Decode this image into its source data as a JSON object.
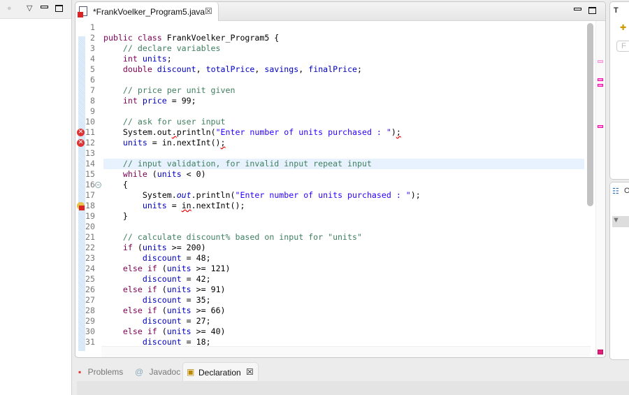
{
  "editor": {
    "tab_title": "*FrankVoelker_Program5.java",
    "close_glyph": "☒"
  },
  "code_lines": [
    [],
    [
      [
        "kw",
        "public class "
      ],
      [
        "",
        "FrankVoelker_Program5 {"
      ]
    ],
    [
      [
        "",
        "    "
      ],
      [
        "cm",
        "// declare variables"
      ]
    ],
    [
      [
        "",
        "    "
      ],
      [
        "kw",
        "int "
      ],
      [
        "fd",
        "units"
      ],
      [
        "",
        ";"
      ]
    ],
    [
      [
        "",
        "    "
      ],
      [
        "kw",
        "double "
      ],
      [
        "fd",
        "discount"
      ],
      [
        "",
        ", "
      ],
      [
        "fd",
        "totalPrice"
      ],
      [
        "",
        ", "
      ],
      [
        "fd",
        "savings"
      ],
      [
        "",
        ", "
      ],
      [
        "fd",
        "finalPrice"
      ],
      [
        "",
        ";"
      ]
    ],
    [],
    [
      [
        "",
        "    "
      ],
      [
        "cm",
        "// price per unit given"
      ]
    ],
    [
      [
        "",
        "    "
      ],
      [
        "kw",
        "int "
      ],
      [
        "fd",
        "price"
      ],
      [
        "",
        " = 99;"
      ]
    ],
    [],
    [
      [
        "",
        "    "
      ],
      [
        "cm",
        "// ask for user input"
      ]
    ],
    [
      [
        "",
        "    System.out"
      ],
      [
        "err",
        "."
      ],
      [
        "",
        "println("
      ],
      [
        "st",
        "\"Enter number of units purchased : \""
      ],
      [
        "",
        ")"
      ],
      [
        "err",
        ";"
      ]
    ],
    [
      [
        "",
        "    "
      ],
      [
        "fd",
        "units"
      ],
      [
        "",
        " = in.nextInt()"
      ],
      [
        "err",
        ";"
      ]
    ],
    [],
    [
      [
        "",
        "    "
      ],
      [
        "cm",
        "// input validation, for invalid input repeat input"
      ]
    ],
    [
      [
        "",
        "    "
      ],
      [
        "kw",
        "while"
      ],
      [
        "",
        " ("
      ],
      [
        "fd",
        "units"
      ],
      [
        "",
        " < 0)"
      ]
    ],
    [
      [
        "",
        "    {"
      ]
    ],
    [
      [
        "",
        "        System."
      ],
      [
        "sf",
        "out"
      ],
      [
        "",
        ".println("
      ],
      [
        "st",
        "\"Enter number of units purchased : \""
      ],
      [
        "",
        ");"
      ]
    ],
    [
      [
        "",
        "        "
      ],
      [
        "fd",
        "units"
      ],
      [
        "",
        " = "
      ],
      [
        "err",
        "in"
      ],
      [
        "",
        ".nextInt();"
      ]
    ],
    [
      [
        "",
        "    }"
      ]
    ],
    [],
    [
      [
        "",
        "    "
      ],
      [
        "cm",
        "// calculate discount% based on input for \"units\""
      ]
    ],
    [
      [
        "",
        "    "
      ],
      [
        "kw",
        "if"
      ],
      [
        "",
        " ("
      ],
      [
        "fd",
        "units"
      ],
      [
        "",
        " >= 200)"
      ]
    ],
    [
      [
        "",
        "        "
      ],
      [
        "fd",
        "discount"
      ],
      [
        "",
        " = 48;"
      ]
    ],
    [
      [
        "",
        "    "
      ],
      [
        "kw",
        "else if"
      ],
      [
        "",
        " ("
      ],
      [
        "fd",
        "units"
      ],
      [
        "",
        " >= 121)"
      ]
    ],
    [
      [
        "",
        "        "
      ],
      [
        "fd",
        "discount"
      ],
      [
        "",
        " = 42;"
      ]
    ],
    [
      [
        "",
        "    "
      ],
      [
        "kw",
        "else if"
      ],
      [
        "",
        " ("
      ],
      [
        "fd",
        "units"
      ],
      [
        "",
        " >= 91)"
      ]
    ],
    [
      [
        "",
        "        "
      ],
      [
        "fd",
        "discount"
      ],
      [
        "",
        " = 35;"
      ]
    ],
    [
      [
        "",
        "    "
      ],
      [
        "kw",
        "else if"
      ],
      [
        "",
        " ("
      ],
      [
        "fd",
        "units"
      ],
      [
        "",
        " >= 66)"
      ]
    ],
    [
      [
        "",
        "        "
      ],
      [
        "fd",
        "discount"
      ],
      [
        "",
        " = 27;"
      ]
    ],
    [
      [
        "",
        "    "
      ],
      [
        "kw",
        "else if"
      ],
      [
        "",
        " ("
      ],
      [
        "fd",
        "units"
      ],
      [
        "",
        " >= 40)"
      ]
    ],
    [
      [
        "",
        "        "
      ],
      [
        "fd",
        "discount"
      ],
      [
        "",
        " = 18;"
      ]
    ]
  ],
  "current_line": 14,
  "error_lines": [
    11,
    12
  ],
  "warning_error_lines": [
    18
  ],
  "fold_lines": [
    16
  ],
  "bottom_tabs": {
    "problems": "Problems",
    "javadoc": "Javadoc",
    "declaration": "Declaration",
    "close_glyph": "☒",
    "at_glyph": "@"
  },
  "right_panel": {
    "top_letter": "T",
    "outline_letter": "O",
    "filter_letter": "F"
  }
}
